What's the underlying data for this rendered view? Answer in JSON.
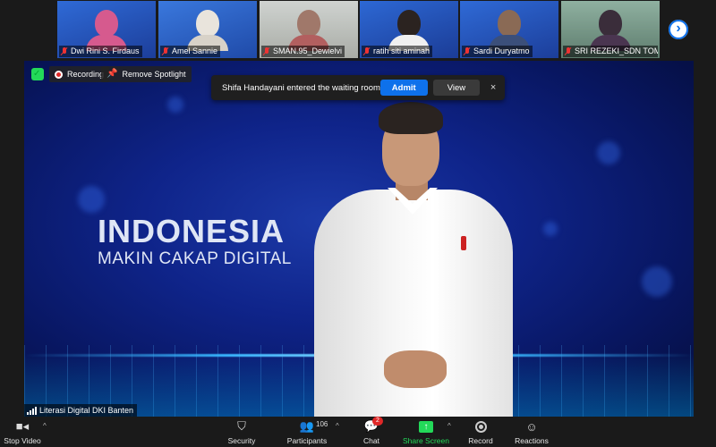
{
  "gallery": {
    "tiles": [
      {
        "name": "Dwi Rini S. Firdaus"
      },
      {
        "name": "Amel Sannie"
      },
      {
        "name": "SMAN.95_Dewielvi"
      },
      {
        "name": "ratih siti aminah"
      },
      {
        "name": "Sardi Duryatmo"
      },
      {
        "name": "SRI REZEKI_SDN TOM..."
      }
    ],
    "next_icon": "chevron-right-icon",
    "next_glyph": "›"
  },
  "stage": {
    "security_icon": "shield-check-icon",
    "recording_label": "Recording",
    "remove_spotlight_label": "Remove Spotlight",
    "background_line1": "INDONESIA",
    "background_line2": "MAKIN CAKAP DIGITAL",
    "speaker_name": "Literasi Digital DKI Banten"
  },
  "notification": {
    "message": "Shifa Handayani entered the waiting room",
    "admit_label": "Admit",
    "view_label": "View",
    "close_glyph": "×"
  },
  "toolbar": {
    "stop_video_label": "Stop Video",
    "security_label": "Security",
    "participants_label": "Participants",
    "participants_count": "106",
    "chat_label": "Chat",
    "chat_badge": "2",
    "share_screen_label": "Share Screen",
    "record_label": "Record",
    "reactions_label": "Reactions",
    "caret_glyph": "^"
  },
  "colors": {
    "accent_blue": "#0e71eb",
    "share_green": "#23d959",
    "recording_red": "#e02828"
  }
}
